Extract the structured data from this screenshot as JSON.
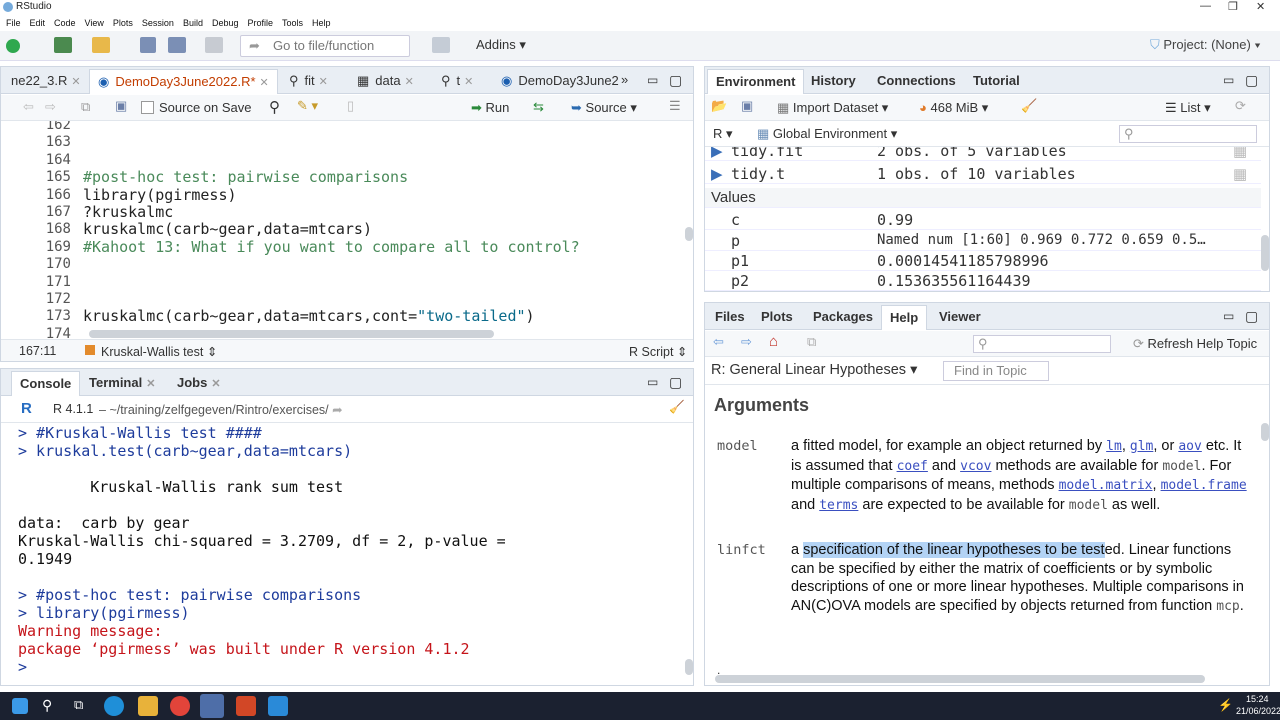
{
  "window": {
    "title": "RStudio"
  },
  "menu": [
    "File",
    "Edit",
    "Code",
    "View",
    "Plots",
    "Session",
    "Build",
    "Debug",
    "Profile",
    "Tools",
    "Help"
  ],
  "toolbar": {
    "goto_placeholder": "Go to file/function",
    "addins": "Addins",
    "project": "Project: (None)"
  },
  "editor": {
    "tabs": [
      {
        "label": "ne22_3.R"
      },
      {
        "label": "DemoDay3June2022.R*"
      },
      {
        "label": "fit"
      },
      {
        "label": "data"
      },
      {
        "label": "t"
      },
      {
        "label": "DemoDay3June2"
      }
    ],
    "source_on_save": "Source on Save",
    "run": "Run",
    "source": "Source",
    "lines": [
      {
        "n": "162",
        "code": ""
      },
      {
        "n": "163",
        "code": ""
      },
      {
        "n": "164",
        "code": ""
      },
      {
        "n": "165",
        "code": "#post-hoc test: pairwise comparisons"
      },
      {
        "n": "166",
        "code": "library(pgirmess)"
      },
      {
        "n": "167",
        "code": "?kruskalmc"
      },
      {
        "n": "168",
        "code": "kruskalmc(carb~gear,data=mtcars)"
      },
      {
        "n": "169",
        "code": "#Kahoot 13: What if you want to compare all to control?"
      },
      {
        "n": "170",
        "code": ""
      },
      {
        "n": "171",
        "code": ""
      },
      {
        "n": "172",
        "code": ""
      },
      {
        "n": "173",
        "code": "kruskalmc(carb~gear,data=mtcars,cont=\"two-tailed\")"
      },
      {
        "n": "174",
        "code": ""
      }
    ],
    "status_pos": "167:11",
    "status_section": "Kruskal-Wallis test",
    "status_type": "R Script"
  },
  "console": {
    "tabs": [
      "Console",
      "Terminal",
      "Jobs"
    ],
    "r_version": "R 4.1.1",
    "path": "~/training/zelfgegeven/Rintro/exercises/",
    "lines": [
      "> #Kruskal-Wallis test ####",
      "> kruskal.test(carb~gear,data=mtcars)",
      "",
      "        Kruskal-Wallis rank sum test",
      "",
      "data:  carb by gear",
      "Kruskal-Wallis chi-squared = 3.2709, df = 2, p-value =",
      "0.1949",
      "",
      "> #post-hoc test: pairwise comparisons",
      "> library(pgirmess)",
      "Warning message:",
      "package ‘pgirmess’ was built under R version 4.1.2",
      ">"
    ]
  },
  "environment": {
    "tabs": [
      "Environment",
      "History",
      "Connections",
      "Tutorial"
    ],
    "import_dataset": "Import Dataset",
    "memory": "468 MiB",
    "list": "List",
    "lang": "R",
    "scope": "Global Environment",
    "rows": [
      {
        "name": "tidy.fit",
        "value": "2 obs. of 5 variables"
      },
      {
        "name": "tidy.t",
        "value": "1 obs. of 10 variables"
      }
    ],
    "values_header": "Values",
    "values": [
      {
        "name": "c",
        "value": "0.99"
      },
      {
        "name": "p",
        "value": "Named num [1:60] 0.969 0.772 0.659 0.5…"
      },
      {
        "name": "p1",
        "value": "0.00014541185798996"
      },
      {
        "name": "p2",
        "value": "0.153635561164439"
      }
    ]
  },
  "help": {
    "tabs": [
      "Files",
      "Plots",
      "Packages",
      "Help",
      "Viewer"
    ],
    "refresh": "Refresh Help Topic",
    "topic": "R: General Linear Hypotheses",
    "find_placeholder": "Find in Topic",
    "heading": "Arguments",
    "model_name": "model",
    "linfct_name": "linfct"
  },
  "taskbar": {
    "time": "15:24",
    "date": "21/06/2022"
  },
  "colors": {
    "accent": "#1e3c9c",
    "error": "#c5141a",
    "comment": "#4a8a5a",
    "active_tab": "#ffffff"
  }
}
